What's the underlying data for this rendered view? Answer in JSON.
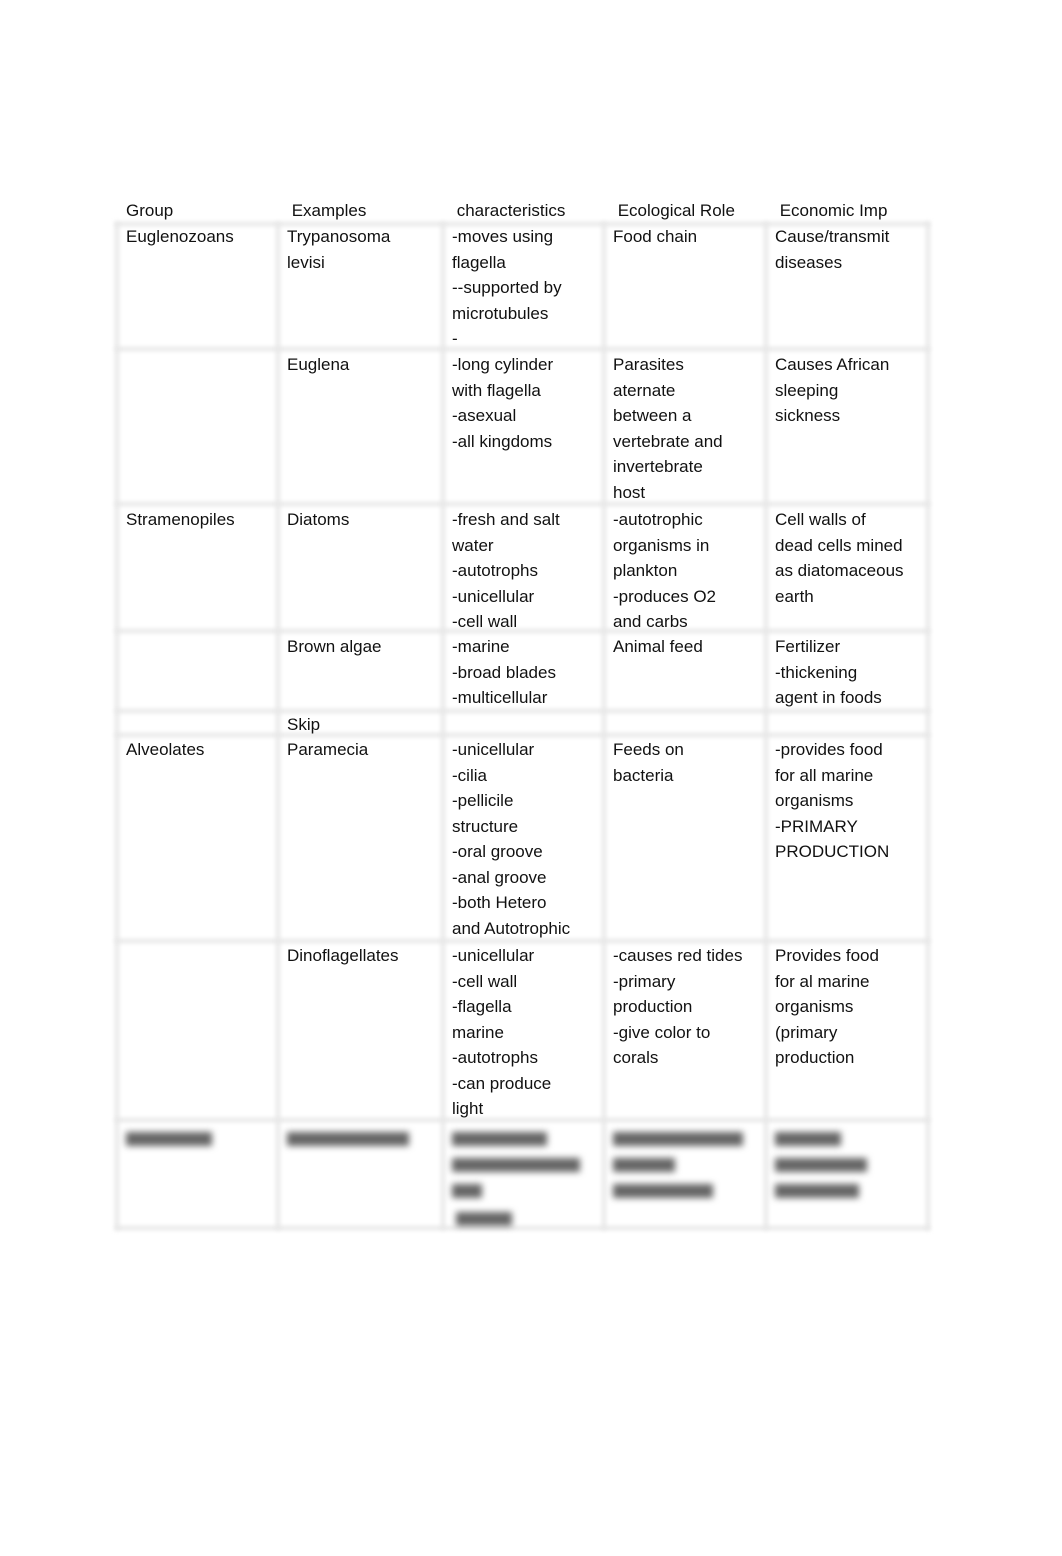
{
  "table": {
    "headers": [
      "Group",
      " Examples",
      " characteristics",
      " Ecological Role",
      " Economic Imp"
    ],
    "rows": [
      {
        "cells": [
          "Euglenozoans",
          "Trypanosoma\nlevisi",
          "-moves using\nflagella\n--supported by\nmicrotubules\n-",
          "Food chain",
          "Cause/transmit\ndiseases"
        ]
      },
      {
        "cells": [
          "",
          "Euglena",
          "-long cylinder\nwith flagella\n-asexual\n-all kingdoms",
          "Parasites\naternate\nbetween a\nvertebrate and\ninvertebrate\nhost",
          "Causes African\nsleeping\nsickness"
        ]
      },
      {
        "cells": [
          "Stramenopiles",
          "Diatoms",
          "-fresh and salt\nwater\n-autotrophs\n-unicellular\n-cell wall",
          "-autotrophic\norganisms in\nplankton\n-produces O2\nand carbs",
          "Cell walls of\ndead cells mined\nas diatomaceous\nearth"
        ]
      },
      {
        "cells": [
          "",
          "Brown algae",
          "-marine\n-broad blades\n-multicellular",
          "Animal feed",
          "Fertilizer\n-thickening\nagent in foods"
        ]
      },
      {
        "cells": [
          "",
          "Skip",
          "",
          "",
          ""
        ]
      },
      {
        "cells": [
          "Alveolates",
          "Paramecia",
          "-unicellular\n-cilia\n-pellicile\nstructure\n-oral groove\n-anal groove\n-both Hetero\nand Autotrophic",
          "Feeds on\nbacteria",
          "-provides food\nfor all marine\norganisms\n-PRIMARY\nPRODUCTION"
        ]
      },
      {
        "cells": [
          "",
          "Dinoflagellates",
          "-unicellular\n-cell wall\n-flagella\nmarine\n-autotrophs\n-can produce\nlight",
          "-causes red tides\n-primary\nproduction\n-give color to\ncorals",
          "Provides food\nfor al marine\norganisms\n(primary\nproduction"
        ]
      }
    ]
  }
}
